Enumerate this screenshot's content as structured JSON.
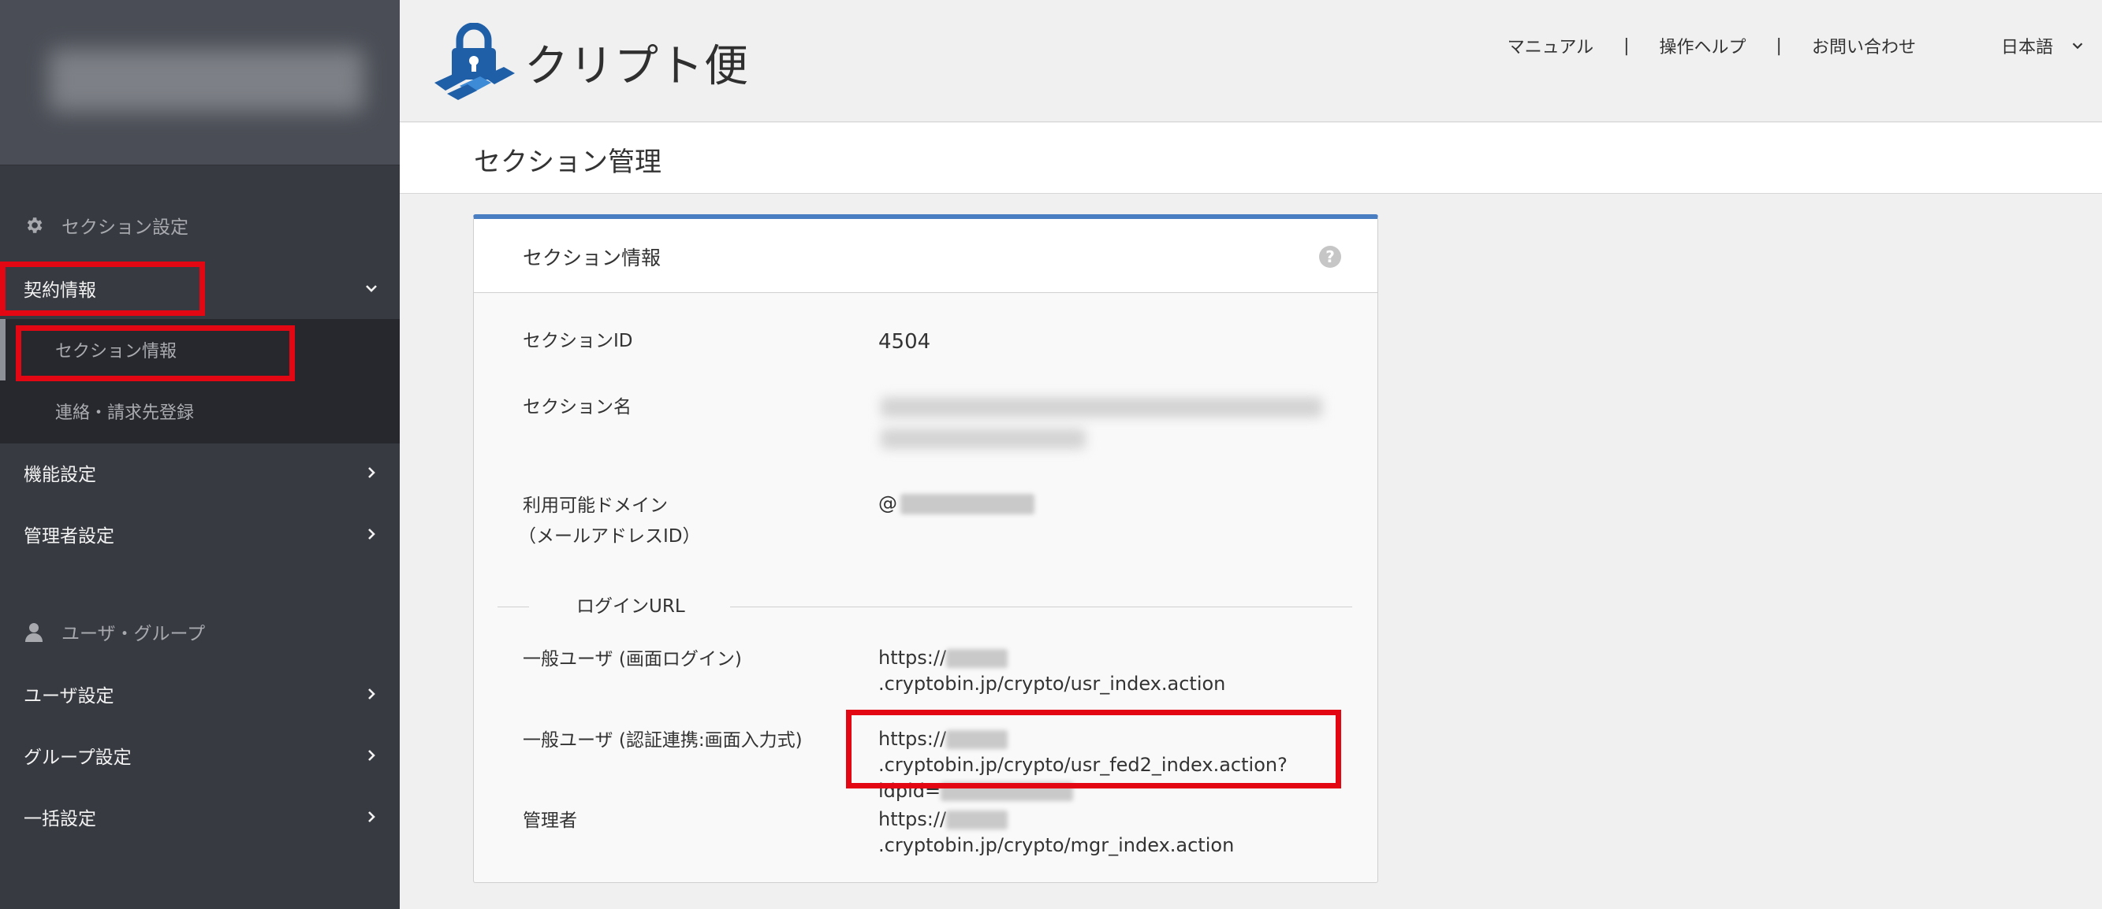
{
  "sidebar": {
    "section_settings": "セクション設定",
    "contract_info": "契約情報",
    "sub_items": [
      "セクション情報",
      "連絡・請求先登録"
    ],
    "function_settings": "機能設定",
    "admin_settings": "管理者設定",
    "users_groups": "ユーザ・グループ",
    "user_settings": "ユーザ設定",
    "group_settings": "グループ設定",
    "bulk_settings": "一括設定"
  },
  "header": {
    "logo_text": "クリプト便",
    "nav": [
      "マニュアル",
      "操作ヘルプ",
      "お問い合わせ"
    ],
    "separator": "|",
    "language": "日本語"
  },
  "page": {
    "title": "セクション管理"
  },
  "panel": {
    "title": "セクション情報",
    "help_icon": "?",
    "fields": {
      "section_id_label": "セクションID",
      "section_id_value": "4504",
      "section_name_label": "セクション名",
      "domain_label_1": "利用可能ドメイン",
      "domain_label_2": "（メールアドレスID）",
      "domain_prefix": "@"
    },
    "login_url_heading": "ログインURL",
    "urls": {
      "general_label": "一般ユーザ (画面ログイン)",
      "general_prefix": "https://",
      "general_rest": ".cryptobin.jp/crypto/usr_index.action",
      "fed_label": "一般ユーザ (認証連携:画面入力式)",
      "fed_prefix": "https://",
      "fed_rest_1": ".cryptobin.jp/crypto/usr_fed2_inde",
      "fed_rest_2": "x.action?idpid=",
      "admin_label": "管理者",
      "admin_prefix": "https://",
      "admin_rest": ".cryptobin.jp/crypto/mgr_index.action"
    }
  },
  "colors": {
    "sidebar_bg": "#373a41",
    "highlight": "#e30613",
    "panel_accent": "#4a7ec3"
  }
}
